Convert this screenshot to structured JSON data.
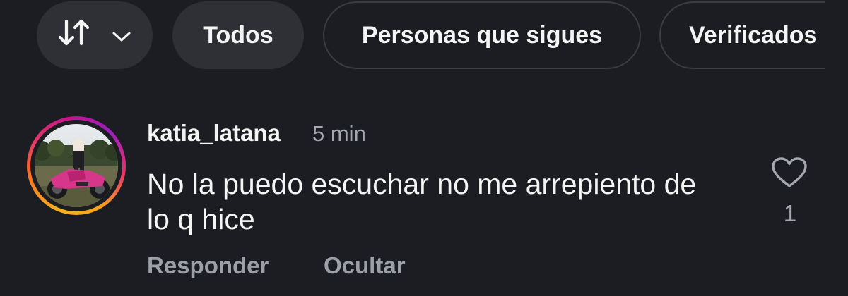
{
  "filters": {
    "sort_icon": "sort-arrows-icon",
    "sort_dropdown_icon": "chevron-down-icon",
    "todos_label": "Todos",
    "following_label": "Personas que sigues",
    "verified_label": "Verificados"
  },
  "comment": {
    "username": "katia_latana",
    "timestamp": "5 min",
    "text": "No la puedo escuchar no me arrepiento de lo q hice",
    "like_icon": "heart-outline-icon",
    "like_count": "1",
    "reply_label": "Responder",
    "hide_label": "Ocultar",
    "avatar_ring_colors": [
      "#f5b31c",
      "#e7326a",
      "#9b1fbf"
    ]
  }
}
